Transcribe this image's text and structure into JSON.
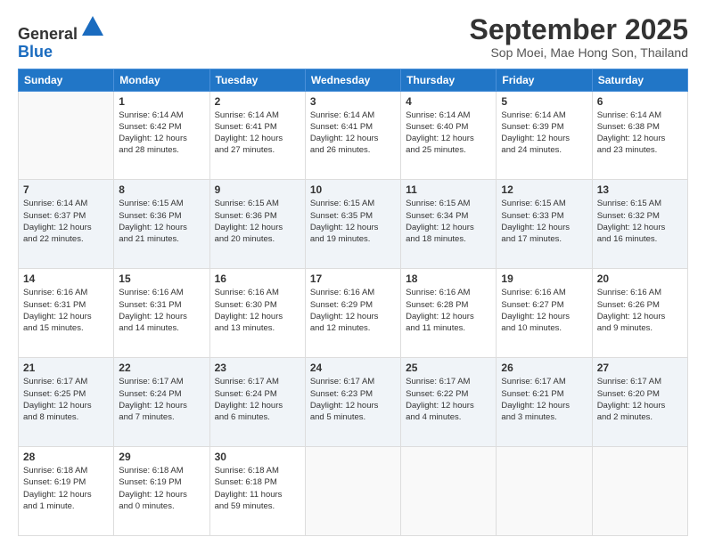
{
  "header": {
    "logo_line1": "General",
    "logo_line2": "Blue",
    "month_title": "September 2025",
    "location": "Sop Moei, Mae Hong Son, Thailand"
  },
  "days_of_week": [
    "Sunday",
    "Monday",
    "Tuesday",
    "Wednesday",
    "Thursday",
    "Friday",
    "Saturday"
  ],
  "weeks": [
    [
      {
        "num": "",
        "info": ""
      },
      {
        "num": "1",
        "info": "Sunrise: 6:14 AM\nSunset: 6:42 PM\nDaylight: 12 hours\nand 28 minutes."
      },
      {
        "num": "2",
        "info": "Sunrise: 6:14 AM\nSunset: 6:41 PM\nDaylight: 12 hours\nand 27 minutes."
      },
      {
        "num": "3",
        "info": "Sunrise: 6:14 AM\nSunset: 6:41 PM\nDaylight: 12 hours\nand 26 minutes."
      },
      {
        "num": "4",
        "info": "Sunrise: 6:14 AM\nSunset: 6:40 PM\nDaylight: 12 hours\nand 25 minutes."
      },
      {
        "num": "5",
        "info": "Sunrise: 6:14 AM\nSunset: 6:39 PM\nDaylight: 12 hours\nand 24 minutes."
      },
      {
        "num": "6",
        "info": "Sunrise: 6:14 AM\nSunset: 6:38 PM\nDaylight: 12 hours\nand 23 minutes."
      }
    ],
    [
      {
        "num": "7",
        "info": "Sunrise: 6:14 AM\nSunset: 6:37 PM\nDaylight: 12 hours\nand 22 minutes."
      },
      {
        "num": "8",
        "info": "Sunrise: 6:15 AM\nSunset: 6:36 PM\nDaylight: 12 hours\nand 21 minutes."
      },
      {
        "num": "9",
        "info": "Sunrise: 6:15 AM\nSunset: 6:36 PM\nDaylight: 12 hours\nand 20 minutes."
      },
      {
        "num": "10",
        "info": "Sunrise: 6:15 AM\nSunset: 6:35 PM\nDaylight: 12 hours\nand 19 minutes."
      },
      {
        "num": "11",
        "info": "Sunrise: 6:15 AM\nSunset: 6:34 PM\nDaylight: 12 hours\nand 18 minutes."
      },
      {
        "num": "12",
        "info": "Sunrise: 6:15 AM\nSunset: 6:33 PM\nDaylight: 12 hours\nand 17 minutes."
      },
      {
        "num": "13",
        "info": "Sunrise: 6:15 AM\nSunset: 6:32 PM\nDaylight: 12 hours\nand 16 minutes."
      }
    ],
    [
      {
        "num": "14",
        "info": "Sunrise: 6:16 AM\nSunset: 6:31 PM\nDaylight: 12 hours\nand 15 minutes."
      },
      {
        "num": "15",
        "info": "Sunrise: 6:16 AM\nSunset: 6:31 PM\nDaylight: 12 hours\nand 14 minutes."
      },
      {
        "num": "16",
        "info": "Sunrise: 6:16 AM\nSunset: 6:30 PM\nDaylight: 12 hours\nand 13 minutes."
      },
      {
        "num": "17",
        "info": "Sunrise: 6:16 AM\nSunset: 6:29 PM\nDaylight: 12 hours\nand 12 minutes."
      },
      {
        "num": "18",
        "info": "Sunrise: 6:16 AM\nSunset: 6:28 PM\nDaylight: 12 hours\nand 11 minutes."
      },
      {
        "num": "19",
        "info": "Sunrise: 6:16 AM\nSunset: 6:27 PM\nDaylight: 12 hours\nand 10 minutes."
      },
      {
        "num": "20",
        "info": "Sunrise: 6:16 AM\nSunset: 6:26 PM\nDaylight: 12 hours\nand 9 minutes."
      }
    ],
    [
      {
        "num": "21",
        "info": "Sunrise: 6:17 AM\nSunset: 6:25 PM\nDaylight: 12 hours\nand 8 minutes."
      },
      {
        "num": "22",
        "info": "Sunrise: 6:17 AM\nSunset: 6:24 PM\nDaylight: 12 hours\nand 7 minutes."
      },
      {
        "num": "23",
        "info": "Sunrise: 6:17 AM\nSunset: 6:24 PM\nDaylight: 12 hours\nand 6 minutes."
      },
      {
        "num": "24",
        "info": "Sunrise: 6:17 AM\nSunset: 6:23 PM\nDaylight: 12 hours\nand 5 minutes."
      },
      {
        "num": "25",
        "info": "Sunrise: 6:17 AM\nSunset: 6:22 PM\nDaylight: 12 hours\nand 4 minutes."
      },
      {
        "num": "26",
        "info": "Sunrise: 6:17 AM\nSunset: 6:21 PM\nDaylight: 12 hours\nand 3 minutes."
      },
      {
        "num": "27",
        "info": "Sunrise: 6:17 AM\nSunset: 6:20 PM\nDaylight: 12 hours\nand 2 minutes."
      }
    ],
    [
      {
        "num": "28",
        "info": "Sunrise: 6:18 AM\nSunset: 6:19 PM\nDaylight: 12 hours\nand 1 minute."
      },
      {
        "num": "29",
        "info": "Sunrise: 6:18 AM\nSunset: 6:19 PM\nDaylight: 12 hours\nand 0 minutes."
      },
      {
        "num": "30",
        "info": "Sunrise: 6:18 AM\nSunset: 6:18 PM\nDaylight: 11 hours\nand 59 minutes."
      },
      {
        "num": "",
        "info": ""
      },
      {
        "num": "",
        "info": ""
      },
      {
        "num": "",
        "info": ""
      },
      {
        "num": "",
        "info": ""
      }
    ]
  ]
}
